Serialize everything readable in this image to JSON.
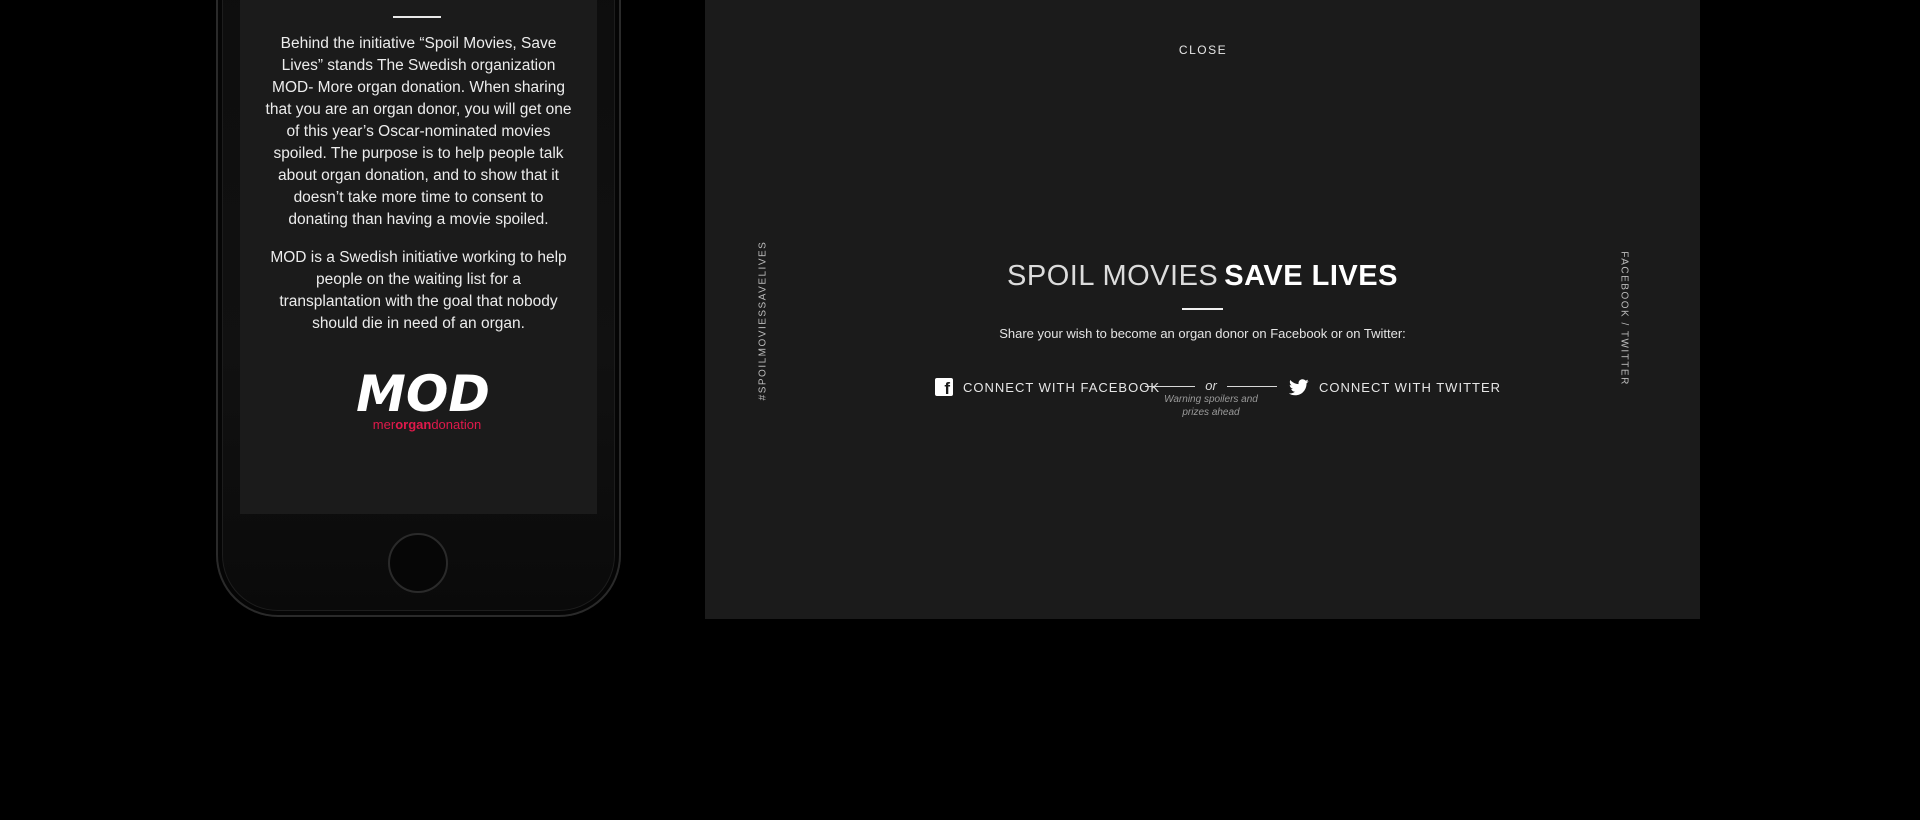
{
  "phone": {
    "paragraph1": "Behind the initiative “Spoil Movies, Save Lives” stands The Swedish organization MOD- More organ donation. When sharing that you are an organ donor, you will get one of this year’s Oscar-nominated movies spoiled. The purpose is to help people talk about organ donation, and to show that it doesn’t take more time to consent to donating than having a movie spoiled.",
    "paragraph2": "MOD is a Swedish initiative working to help people on the waiting list for a transplantation with the goal that nobody should die in need of an organ.",
    "logo": {
      "wordmark": "MOD",
      "tagline_pre": "mer",
      "tagline_mid": "organ",
      "tagline_post": "donation",
      "accent_color": "#e0194b"
    }
  },
  "panel": {
    "close_label": "CLOSE",
    "side_hashtag": "#SPOILMOVIESSAVELIVES",
    "side_social": "FACEBOOK / TWITTER",
    "title_light": "SPOIL MOVIES",
    "title_bold": "SAVE LIVES",
    "subtitle": "Share your wish to become an organ donor on Facebook or on Twitter:",
    "facebook_label": "CONNECT WITH FACEBOOK",
    "twitter_label": "CONNECT WITH TWITTER",
    "or_label": "or",
    "warning": "Warning spoilers and prizes ahead",
    "icons": [
      "facebook-icon",
      "twitter-icon"
    ]
  },
  "colors": {
    "background": "#000000",
    "panel": "#1b1b1b",
    "text": "#ffffff"
  }
}
